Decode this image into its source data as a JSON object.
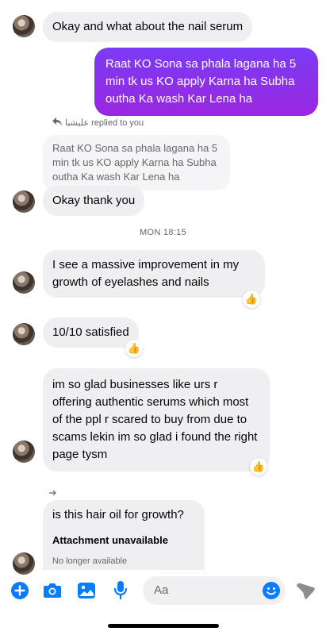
{
  "messages": {
    "m1": "Okay and what about the nail serum",
    "m2_out": "Raat KO Sona sa phala lagana ha 5 min tk us KO apply Karna ha Subha outha Ka wash Kar Lena ha",
    "reply_info": "علیشبا replied to you",
    "quoted": "Raat KO Sona sa phala lagana ha 5 min tk us KO apply Karna ha Subha outha Ka wash Kar Lena ha",
    "m3": "Okay thank you",
    "timestamp": "MON 18:15",
    "m4": "I see a massive improvement in my growth of eyelashes and nails",
    "m5": "10/10 satisfied",
    "m6": "im so glad businesses like urs r offering authentic serums which most of the ppl r scared to buy from due to scams lekin im so glad i found the right page tysm",
    "m7": "is this hair oil for growth?",
    "attachment_title": "Attachment unavailable",
    "attachment_sub": "No longer available"
  },
  "reactions": {
    "thumbs": "👍"
  },
  "composer": {
    "placeholder": "Aa"
  },
  "colors": {
    "accent": "#0a7cff",
    "outgoing_gradient_top": "#7b3bf5",
    "outgoing_gradient_bottom": "#9a27e0",
    "incoming_bubble": "#efeff1"
  },
  "icons": [
    "plus-icon",
    "camera-icon",
    "gallery-icon",
    "microphone-icon",
    "emoji-icon",
    "send-icon",
    "reply-arrow-icon",
    "forward-arrow-icon"
  ]
}
